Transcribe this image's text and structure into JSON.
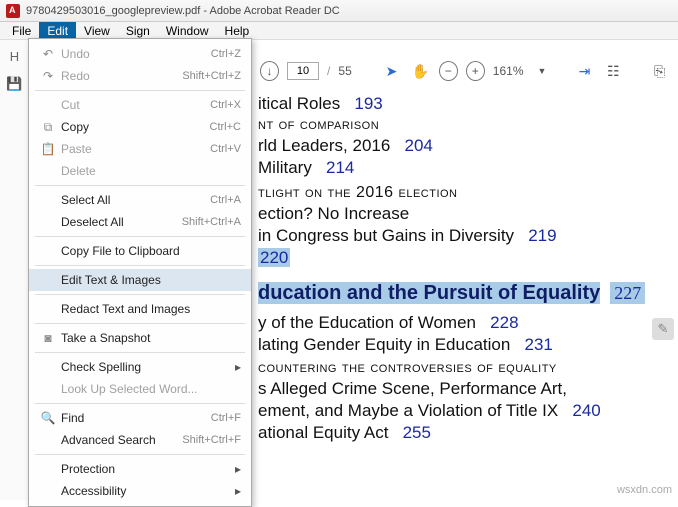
{
  "window": {
    "title": "9780429503016_googlepreview.pdf - Adobe Acrobat Reader DC"
  },
  "menubar": [
    "File",
    "Edit",
    "View",
    "Sign",
    "Window",
    "Help"
  ],
  "edit_menu": {
    "undo": "Undo",
    "undo_sc": "Ctrl+Z",
    "redo": "Redo",
    "redo_sc": "Shift+Ctrl+Z",
    "cut": "Cut",
    "cut_sc": "Ctrl+X",
    "copy": "Copy",
    "copy_sc": "Ctrl+C",
    "paste": "Paste",
    "paste_sc": "Ctrl+V",
    "delete": "Delete",
    "select_all": "Select All",
    "select_all_sc": "Ctrl+A",
    "deselect_all": "Deselect All",
    "deselect_all_sc": "Shift+Ctrl+A",
    "copy_file": "Copy File to Clipboard",
    "edit_ti": "Edit Text & Images",
    "redact": "Redact Text and Images",
    "snapshot": "Take a Snapshot",
    "check_spelling": "Check Spelling",
    "lookup": "Look Up Selected Word...",
    "find": "Find",
    "find_sc": "Ctrl+F",
    "adv_search": "Advanced Search",
    "adv_search_sc": "Shift+Ctrl+F",
    "protection": "Protection",
    "accessibility": "Accessibility"
  },
  "toolbar": {
    "page_current": "10",
    "page_total": "55",
    "zoom": "161%"
  },
  "doc": {
    "l1a": "itical Roles",
    "l1n": "193",
    "l2": "nt of comparison",
    "l3a": "rld Leaders, 2016",
    "l3n": "204",
    "l4a": " Military",
    "l4n": "214",
    "l5": "tlight on the 2016 election",
    "l6": "ection? No Increase",
    "l7a": "in Congress but Gains in Diversity",
    "l7n": "219",
    "l8": "220",
    "h1": "ducation and the Pursuit of Equality",
    "h1n": "227",
    "l9a": "y of the Education of Women",
    "l9n": "228",
    "l10a": "lating Gender Equity in Education",
    "l10n": "231",
    "l11": "countering the controversies of equality",
    "l12": "s Alleged Crime Scene, Performance Art,",
    "l13a": "ement, and Maybe a Violation of Title IX",
    "l13n": "240",
    "l14a": "ational Equity Act",
    "l14n": "255"
  },
  "watermark": "wsxdn.com"
}
